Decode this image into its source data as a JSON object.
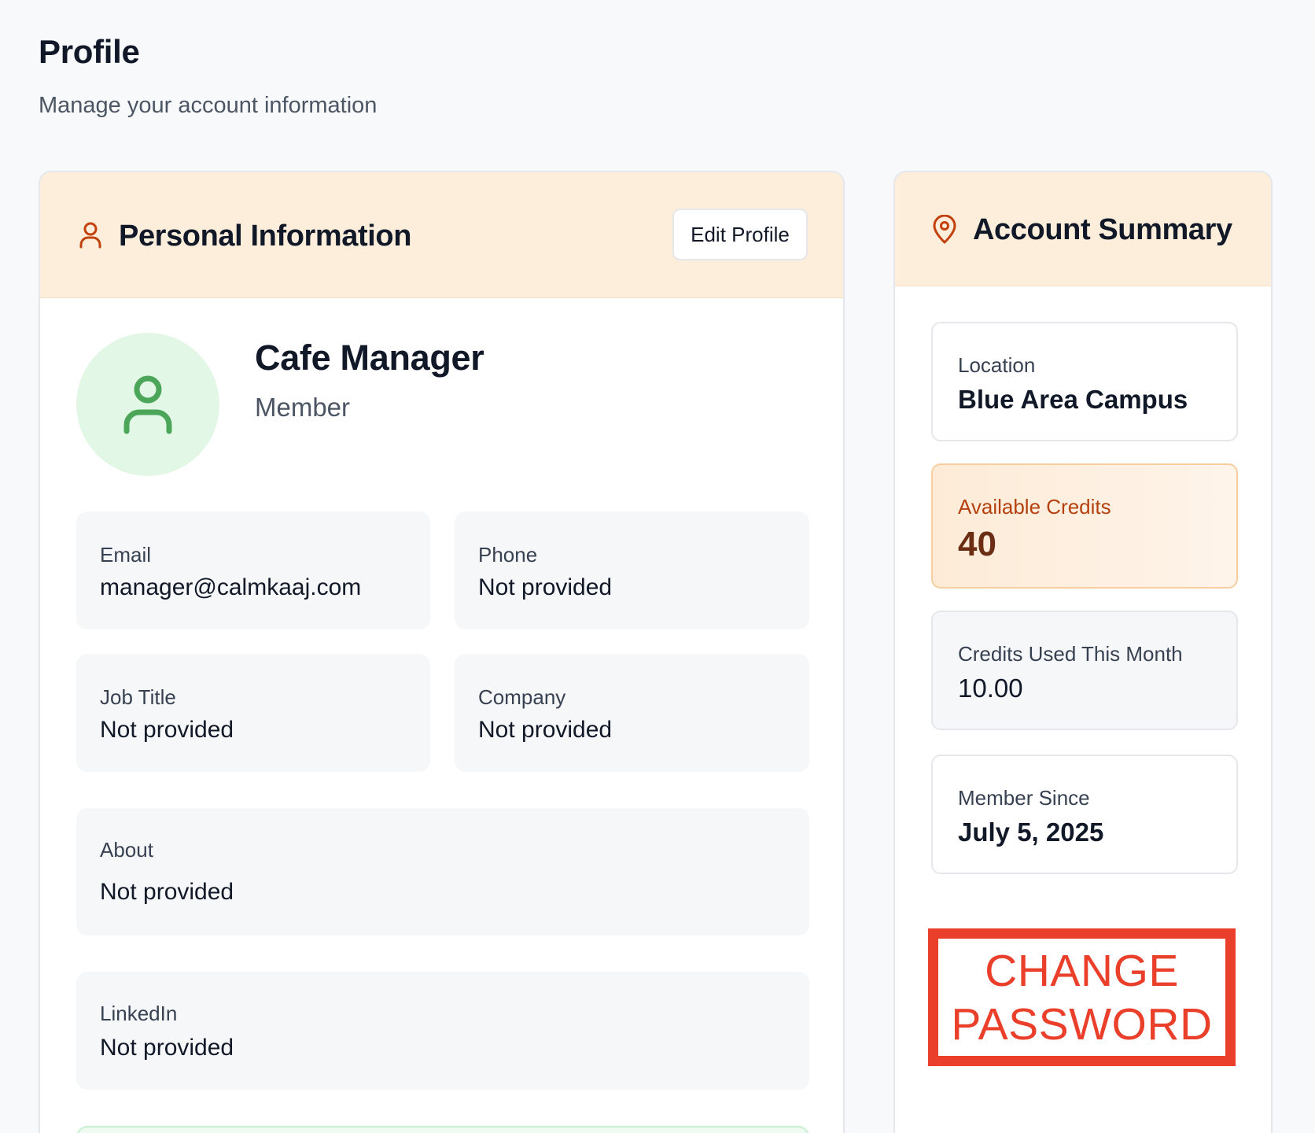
{
  "header": {
    "title": "Profile",
    "subtitle": "Manage your account information"
  },
  "personal_info": {
    "title": "Personal Information",
    "icon": "user-icon",
    "edit_label": "Edit Profile",
    "user": {
      "name": "Cafe Manager",
      "role": "Member",
      "avatar_icon": "user-icon"
    },
    "fields": {
      "email": {
        "label": "Email",
        "value": "manager@calmkaaj.com"
      },
      "phone": {
        "label": "Phone",
        "value": "Not provided"
      },
      "job_title": {
        "label": "Job Title",
        "value": "Not provided"
      },
      "company": {
        "label": "Company",
        "value": "Not provided"
      },
      "about": {
        "label": "About",
        "value": "Not provided"
      },
      "linkedin": {
        "label": "LinkedIn",
        "value": "Not provided"
      }
    }
  },
  "account_summary": {
    "title": "Account Summary",
    "icon": "map-pin-icon",
    "location": {
      "label": "Location",
      "value": "Blue Area Campus"
    },
    "available_credits": {
      "label": "Available Credits",
      "value": "40"
    },
    "credits_used": {
      "label": "Credits Used This Month",
      "value": "10.00"
    },
    "member_since": {
      "label": "Member Since",
      "value": "July 5, 2025"
    },
    "change_password": {
      "line1": "CHANGE",
      "line2": "PASSWORD"
    }
  },
  "colors": {
    "page_bg": "#f8f9fb",
    "header_bg": "#fdeedb",
    "accent_orange": "#c2410c",
    "avatar_bg": "#e3f7e6",
    "avatar_icon": "#4ca65a",
    "change_password": "#ea3f2a"
  }
}
